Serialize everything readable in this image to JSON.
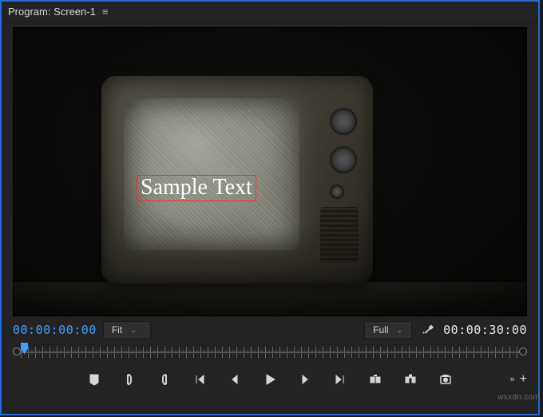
{
  "header": {
    "title": "Program: Screen-1"
  },
  "viewer": {
    "overlay_text": "Sample Text"
  },
  "controls": {
    "current_timecode": "00:00:00:00",
    "zoom_label": "Fit",
    "resolution_label": "Full",
    "duration_timecode": "00:00:30:00"
  },
  "icons": {
    "menu": "≡",
    "chevron_down": "⌄",
    "wrench": "🔧",
    "expand": "»",
    "plus": "+"
  },
  "watermark": "wsxdn.com"
}
